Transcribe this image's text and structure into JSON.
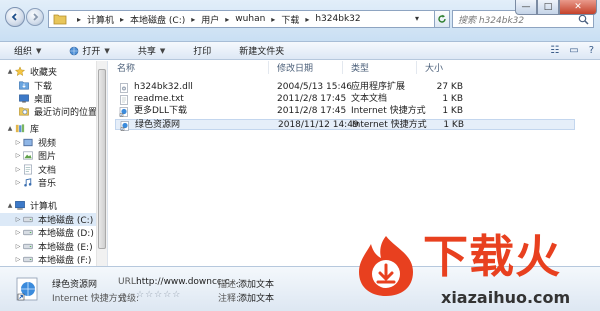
{
  "window": {
    "breadcrumb": [
      "计算机",
      "本地磁盘 (C:)",
      "用户",
      "wuhan",
      "下载",
      "h324bk32"
    ],
    "search_placeholder": "搜索 h324bk32",
    "controls": {
      "minimize": "—",
      "maximize": "□",
      "close": "✕"
    }
  },
  "toolbar": {
    "organize": "组织",
    "open": "打开",
    "share": "共享",
    "print": "打印",
    "new_folder": "新建文件夹"
  },
  "sidebar": {
    "items": [
      {
        "label": "收藏夹",
        "icon": "star-icon",
        "level": 0,
        "expander": "▲"
      },
      {
        "label": "下载",
        "icon": "downloads-folder-icon",
        "level": 1,
        "expander": ""
      },
      {
        "label": "桌面",
        "icon": "desktop-icon",
        "level": 1,
        "expander": ""
      },
      {
        "label": "最近访问的位置",
        "icon": "recent-places-icon",
        "level": 1,
        "expander": ""
      },
      {
        "label": "库",
        "icon": "library-icon",
        "level": 0,
        "expander": "▲"
      },
      {
        "label": "视频",
        "icon": "video-library-icon",
        "level": 1,
        "expander": "▷"
      },
      {
        "label": "图片",
        "icon": "pictures-library-icon",
        "level": 1,
        "expander": "▷"
      },
      {
        "label": "文档",
        "icon": "documents-library-icon",
        "level": 1,
        "expander": "▷"
      },
      {
        "label": "音乐",
        "icon": "music-library-icon",
        "level": 1,
        "expander": "▷"
      },
      {
        "label": "计算机",
        "icon": "computer-icon",
        "level": 0,
        "expander": "▲"
      },
      {
        "label": "本地磁盘 (C:)",
        "icon": "drive-icon",
        "level": 1,
        "expander": "▷",
        "selected": true
      },
      {
        "label": "本地磁盘 (D:)",
        "icon": "drive-icon",
        "level": 1,
        "expander": "▷"
      },
      {
        "label": "本地磁盘 (E:)",
        "icon": "drive-icon",
        "level": 1,
        "expander": "▷"
      },
      {
        "label": "本地磁盘 (F:)",
        "icon": "drive-icon",
        "level": 1,
        "expander": "▷"
      }
    ]
  },
  "filelist": {
    "columns": {
      "name": "名称",
      "modified": "修改日期",
      "type": "类型",
      "size": "大小"
    },
    "rows": [
      {
        "name": "h324bk32.dll",
        "modified": "2004/5/13 15:46",
        "type": "应用程序扩展",
        "size": "27 KB",
        "icon": "dll-file-icon"
      },
      {
        "name": "readme.txt",
        "modified": "2011/2/8 17:45",
        "type": "文本文档",
        "size": "1 KB",
        "icon": "text-file-icon"
      },
      {
        "name": "更多DLL下载",
        "modified": "2011/2/8 17:45",
        "type": "Internet 快捷方式",
        "size": "1 KB",
        "icon": "internet-shortcut-icon"
      },
      {
        "name": "绿色资源网",
        "modified": "2018/11/12 14:49",
        "type": "Internet 快捷方式",
        "size": "1 KB",
        "icon": "internet-shortcut-icon",
        "selected": true
      }
    ]
  },
  "details": {
    "name": "绿色资源网",
    "type": "Internet 快捷方式",
    "url_label": "URL:",
    "url_value": "http://www.downcc.c...",
    "rating_label": "分级:",
    "rating_stars": "☆☆☆☆☆",
    "desc_label": "描述:",
    "desc_value": "添加文本",
    "notes_label": "注释:",
    "notes_value": "添加文本"
  },
  "watermark": {
    "title": "下载火",
    "subtitle": "xiazaihuo.com"
  }
}
